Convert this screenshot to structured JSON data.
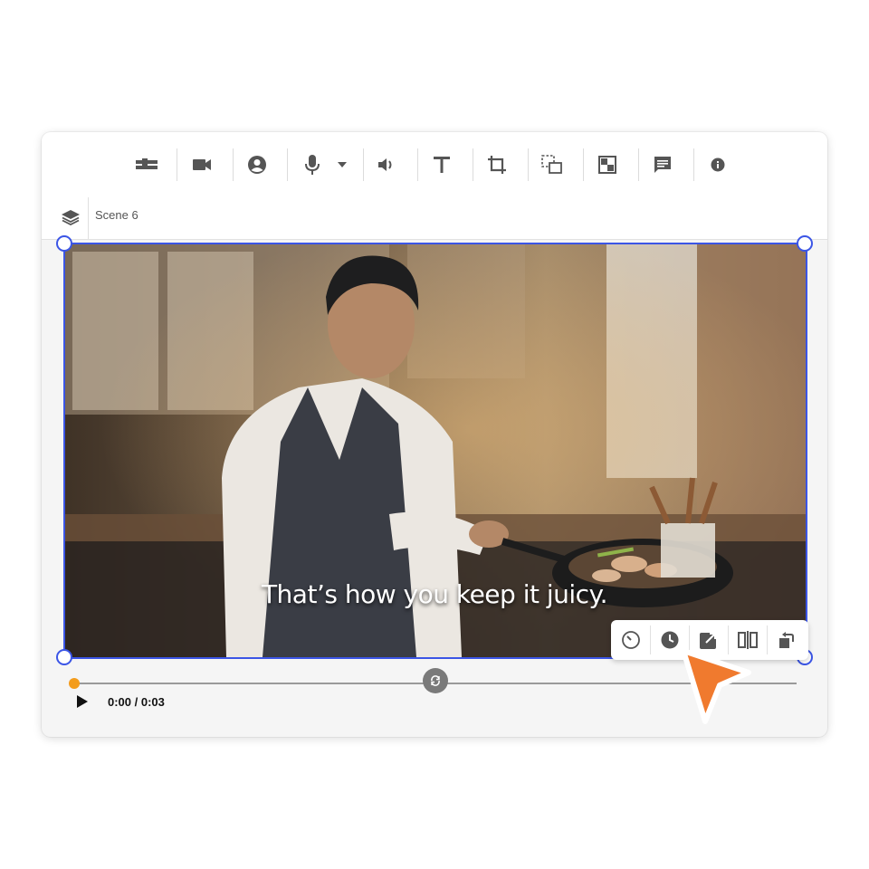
{
  "toolbar": {
    "icons": [
      "layout-icon",
      "video-camera-icon",
      "avatar-icon",
      "microphone-icon",
      "dropdown-arrow-icon",
      "speaker-icon",
      "text-icon",
      "crop-icon",
      "transform-icon",
      "overlay-icon",
      "comment-icon",
      "info-icon"
    ]
  },
  "scene": {
    "name": "Scene 6"
  },
  "video": {
    "caption": "That’s how you keep it juicy."
  },
  "clip_toolbar": {
    "icons": [
      "speed-icon",
      "timer-icon",
      "external-link-icon",
      "split-icon",
      "rotate-icon"
    ]
  },
  "player": {
    "time": "0:00 / 0:03",
    "progress_fraction": 0.0
  },
  "colors": {
    "selection": "#3b55e6",
    "progress": "#f39c1c",
    "cursor": "#f07a2e"
  }
}
